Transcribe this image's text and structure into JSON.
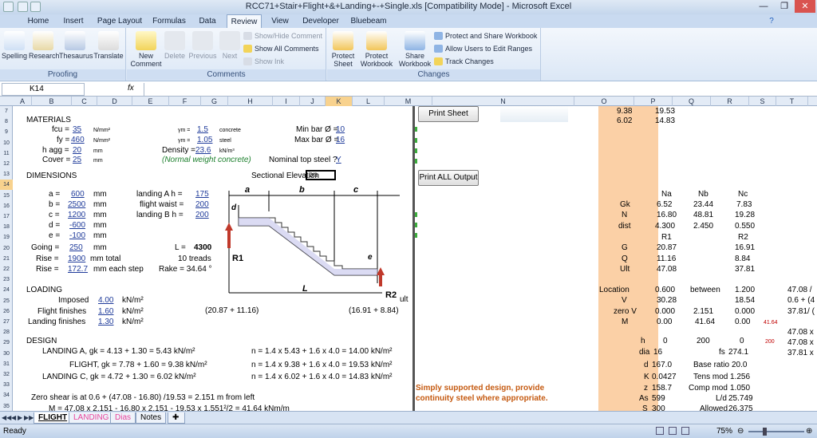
{
  "window": {
    "title": "RCC71+Stair+Flight+&+Landing+-+Single.xls  [Compatibility Mode] - Microsoft Excel"
  },
  "tabs": [
    "Home",
    "Insert",
    "Page Layout",
    "Formulas",
    "Data",
    "Review",
    "View",
    "Developer",
    "Bluebeam"
  ],
  "active_tab": "Review",
  "ribbon": {
    "proofing": {
      "label": "Proofing",
      "spelling": "Spelling",
      "research": "Research",
      "thesaurus": "Thesaurus",
      "translate": "Translate"
    },
    "comments": {
      "label": "Comments",
      "new": "New Comment",
      "delete": "Delete",
      "previous": "Previous",
      "next": "Next",
      "show_hide": "Show/Hide Comment",
      "show_all": "Show All Comments",
      "show_ink": "Show Ink"
    },
    "changes": {
      "label": "Changes",
      "protect_sheet": "Protect Sheet",
      "protect_workbook": "Protect Workbook",
      "share_workbook": "Share Workbook",
      "protect_share": "Protect and Share Workbook",
      "allow_users": "Allow Users to Edit Ranges",
      "track_changes": "Track Changes"
    }
  },
  "formula_bar": {
    "cell": "K14",
    "fx": "fx",
    "value": ""
  },
  "columns": [
    "A",
    "B",
    "C",
    "D",
    "E",
    "F",
    "G",
    "H",
    "I",
    "J",
    "K",
    "L",
    "M",
    "N",
    "O",
    "P",
    "Q",
    "R",
    "S",
    "T"
  ],
  "rows": [
    "7",
    "8",
    "9",
    "10",
    "11",
    "12",
    "13",
    "14",
    "15",
    "16",
    "17",
    "18",
    "19",
    "20",
    "21",
    "22",
    "23",
    "24",
    "25",
    "26",
    "27",
    "28",
    "29",
    "30",
    "31",
    "32",
    "33",
    "34",
    "35",
    "36"
  ],
  "buttons": {
    "print_sheet": "Print Sheet",
    "print_all": "Print ALL Output"
  },
  "materials": {
    "title": "MATERIALS",
    "fcu_label": "fcu =",
    "fcu": "35",
    "fcu_unit": "N/mm²",
    "fy_label": "fy =",
    "fy": "460",
    "fy_unit": "N/mm²",
    "hagg_label": "h agg =",
    "hagg": "20",
    "hagg_unit": "mm",
    "cover_label": "Cover =",
    "cover": "25",
    "cover_unit": "mm",
    "gm1_label": "γm =",
    "gm1": "1.5",
    "gm1_unit": "concrete",
    "gm2_label": "γm =",
    "gm2": "1.05",
    "gm2_unit": "steel",
    "density_label": "Density =",
    "density": "23.6",
    "density_unit": "kN/m³",
    "density_note": "(Normal weight concrete)",
    "minbar_label": "Min bar Ø =",
    "minbar": "10",
    "maxbar_label": "Max bar Ø =",
    "maxbar": "16",
    "nominal_label": "Nominal top steel ?",
    "nominal": "Y"
  },
  "dimensions": {
    "title": "DIMENSIONS",
    "section_label": "Sectional Elevation",
    "section_value": "on",
    "a_label": "a =",
    "a": "600",
    "b_label": "b =",
    "b": "2500",
    "c_label": "c =",
    "c": "1200",
    "d_label": "d =",
    "d": "-600",
    "e_label": "e =",
    "e": "-100",
    "unit": "mm",
    "going_label": "Going =",
    "going": "250",
    "rise_label": "Rise =",
    "rise": "1900",
    "rise_unit": "mm total",
    "rise2_label": "Rise =",
    "rise2": "172.7",
    "rise2_unit": "mm each step",
    "landA_label": "landing A h =",
    "landA": "175",
    "waist_label": "flight waist =",
    "waist": "200",
    "landB_label": "landing B h =",
    "landB": "200",
    "L_label": "L =",
    "L": "4300",
    "treads": "10 treads",
    "rake": "Rake = 34.64 °"
  },
  "diagram": {
    "a": "a",
    "b": "b",
    "c": "c",
    "d": "d",
    "e": "e",
    "L": "L",
    "R1": "R1",
    "R2": "R2",
    "left_note": "(20.87 + 11.16)",
    "right_note": "(16.91 + 8.84)",
    "ult": "ult"
  },
  "loading": {
    "title": "LOADING",
    "imposed_label": "Imposed",
    "imposed": "4.00",
    "flight_label": "Flight finishes",
    "flight": "1.60",
    "landing_label": "Landing finishes",
    "landing": "1.30",
    "unit": "kN/m²"
  },
  "design": {
    "title": "DESIGN",
    "lines": [
      "LANDING A,  gk = 4.13 + 1.30 = 5.43 kN/m²",
      "FLIGHT,  gk = 7.78 + 1.60 = 9.38 kN/m²",
      "LANDING C,  gk = 4.72 + 1.30 = 6.02 kN/m²"
    ],
    "n_lines": [
      "n = 1.4 x 5.43 + 1.6 x 4.0 = 14.00 kN/m²",
      "n = 1.4 x 9.38 + 1.6 x 4.0 = 19.53 kN/m²",
      "n = 1.4 x 6.02 + 1.6 x 4.0 = 14.83 kN/m²"
    ],
    "zero_shear": "Zero shear is at 0.6 + (47.08 - 16.80) /19.53 = 2.151 m from left",
    "moment": "M = 47.08 x 2.151 - 16.80 x 2.151 - 19.53 x 1.551²/2 = 41.64 kNm/m",
    "note1": "Simply supported design, provide",
    "note2": "continuity steel where appropriate."
  },
  "calc": {
    "o7": "9.38",
    "p7": "19.53",
    "o8": "6.02",
    "p8": "14.83",
    "na": "Na",
    "nb": "Nb",
    "nc": "Nc",
    "gk_label": "Gk",
    "gk": [
      "6.52",
      "23.44",
      "7.83"
    ],
    "n_label": "N",
    "n": [
      "16.80",
      "48.81",
      "19.28"
    ],
    "dist_label": "dist",
    "dist": [
      "4.300",
      "2.450",
      "0.550"
    ],
    "r1": "R1",
    "r2": "R2",
    "g_label": "G",
    "g": [
      "20.87",
      "16.91"
    ],
    "q_label": "Q",
    "q": [
      "11.16",
      "8.84"
    ],
    "ult_label": "Ult",
    "ult": [
      "47.08",
      "37.81"
    ],
    "loc_label": "Location",
    "loc": [
      "0.600",
      "between",
      "1.200"
    ],
    "v_label": "V",
    "v": [
      "30.28",
      "18.54"
    ],
    "zv_label": "zero V",
    "zv": [
      "0.000",
      "2.151",
      "0.000"
    ],
    "m_label": "M",
    "m": [
      "0.00",
      "41.64",
      "0.00"
    ],
    "m_red": "41.64",
    "h_label": "h",
    "h": [
      "0",
      "200",
      "0"
    ],
    "h_red": "200",
    "dia_label": "dia",
    "dia": "16",
    "fs_label": "fs",
    "fs": "274.1",
    "d_label": "d",
    "d": "167.0",
    "br_label": "Base ratio",
    "br": "20.0",
    "k_label": "K",
    "k": "0.0427",
    "tm_label": "Tens mod",
    "tm": "1.256",
    "z_label": "z",
    "z": "158.7",
    "cm_label": "Comp mod",
    "cm": "1.050",
    "as_label": "As",
    "as": "599",
    "ld_label": "L/d",
    "ld": "25.749",
    "s_label": "S",
    "s": "300",
    "al_label": "Allowed",
    "al": "26.375",
    "t_col": [
      "47.08 /",
      "0.6 + (4",
      "37.81/ (",
      "47.08 x",
      "47.08 x",
      "37.81 x"
    ]
  },
  "sheet_tabs": [
    "FLIGHT",
    "LANDING",
    "Dias",
    "Notes"
  ],
  "status": {
    "ready": "Ready",
    "zoom": "75%"
  }
}
